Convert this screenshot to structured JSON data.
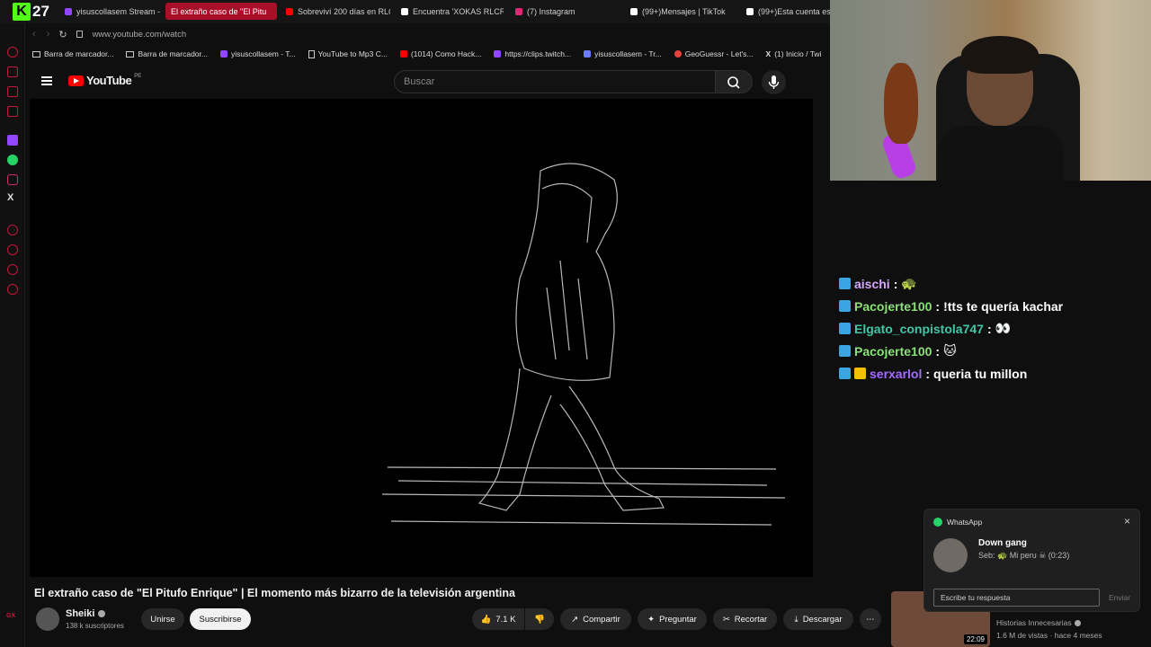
{
  "stream_overlay": {
    "counter": "27"
  },
  "tabs": [
    {
      "label": "yisuscollasem Stream - W",
      "color": "#9146ff"
    },
    {
      "label": "El extraño caso de \"El Pitu",
      "color": "#ff0000",
      "active": true
    },
    {
      "label": "Sobreviví 200 días en RLC",
      "color": "#ff0000"
    },
    {
      "label": "Encuentra 'XOKAS RLCRA",
      "color": "#ffffff"
    },
    {
      "label": "(7) Instagram",
      "color": "#d62976"
    },
    {
      "label": "(99+)Mensajes | TikTok",
      "color": "#ffffff"
    },
    {
      "label": "(99+)Esta cuenta es p",
      "color": "#ffffff"
    }
  ],
  "address": {
    "url": "www.youtube.com/watch"
  },
  "bookmarks": [
    "Barra de marcador...",
    "Barra de marcador...",
    "yisuscollasem - T...",
    "YouTube to Mp3 C...",
    "(1014) Como Hack...",
    "https://clips.twitch...",
    "yisuscollasem - Tr...",
    "GeoGuessr - Let's...",
    "(1) Inicio / Twi"
  ],
  "youtube": {
    "logo_text": "YouTube",
    "country": "PE",
    "search_placeholder": "Buscar"
  },
  "video": {
    "title": "El extraño caso de \"El Pitufo Enrique\" | El momento más bizarro de la televisión argentina",
    "channel": "Sheiki",
    "subscribers": "138 k suscriptores",
    "join_label": "Unirse",
    "subscribe_label": "Suscribirse",
    "likes": "7.1 K",
    "share_label": "Compartir",
    "ask_label": "Preguntar",
    "clip_label": "Recortar",
    "download_label": "Descargar"
  },
  "recommended": {
    "channel": "Historias Innecesarias",
    "meta": "1.6 M de vistas · hace 4 meses",
    "duration": "22:09"
  },
  "chat": [
    {
      "user": "aischi",
      "message": "",
      "color": "#d6a6ff",
      "emote": "🐢"
    },
    {
      "user": "Pacojerte100",
      "message": "!tts te quería kachar",
      "color": "#8be07a"
    },
    {
      "user": "Elgato_conpistola747",
      "message": "👀",
      "color": "#3fc7a6"
    },
    {
      "user": "Pacojerte100",
      "message": "",
      "color": "#8be07a",
      "emote": "🐱"
    },
    {
      "user": "serxarlol",
      "message": "queria tu millon",
      "color": "#a66bff"
    }
  ],
  "whatsapp": {
    "app_name": "WhatsApp",
    "group": "Down gang",
    "preview": "Seb: 🐢 Mi peru ☠ (0:23)",
    "reply_placeholder": "Escribe tu respuesta",
    "send_label": "Enviar"
  }
}
